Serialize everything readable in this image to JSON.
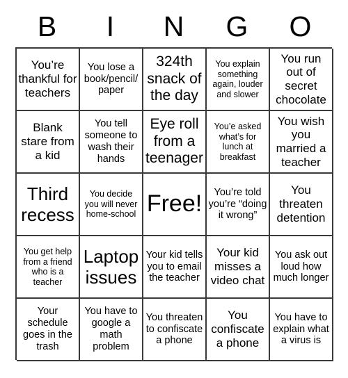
{
  "card": {
    "title": "BINGO",
    "header_letters": [
      "B",
      "I",
      "N",
      "G",
      "O"
    ],
    "grid_size": "5x5",
    "free_space_label": "Free!",
    "colors": {
      "background": "#ffffff",
      "text": "#000000",
      "border": "#3a3a3a"
    },
    "rows": [
      [
        {
          "text": "You’re thankful for teachers",
          "size": "md"
        },
        {
          "text": "You lose a book/pencil/paper",
          "size": "sm"
        },
        {
          "text": "324th snack of the day",
          "size": "lg"
        },
        {
          "text": "You explain something again, louder and slower",
          "size": "xs"
        },
        {
          "text": "You run out of secret chocolate",
          "size": "md"
        }
      ],
      [
        {
          "text": "Blank stare from a kid",
          "size": "md"
        },
        {
          "text": "You tell someone to wash their hands",
          "size": "sm"
        },
        {
          "text": "Eye roll from a teenager",
          "size": "lg"
        },
        {
          "text": "You’e asked what’s for lunch at breakfast",
          "size": "xs"
        },
        {
          "text": "You wish you married a teacher",
          "size": "md"
        }
      ],
      [
        {
          "text": "Third recess",
          "size": "xl"
        },
        {
          "text": "You decide you will never home-school",
          "size": "xs"
        },
        {
          "text": "Free!",
          "size": "xxl"
        },
        {
          "text": "You’re told you’re “doing it wrong”",
          "size": "sm"
        },
        {
          "text": "You threaten detention",
          "size": "md"
        }
      ],
      [
        {
          "text": "You get help from a friend who is a teacher",
          "size": "xs"
        },
        {
          "text": "Laptop issues",
          "size": "xl"
        },
        {
          "text": "Your kid tells you to email the teacher",
          "size": "sm"
        },
        {
          "text": "Your kid misses a video chat",
          "size": "md"
        },
        {
          "text": "You ask out loud how much longer",
          "size": "sm"
        }
      ],
      [
        {
          "text": "Your schedule goes in the trash",
          "size": "sm"
        },
        {
          "text": "You have to google a math problem",
          "size": "sm"
        },
        {
          "text": "You threaten to confiscate a phone",
          "size": "sm"
        },
        {
          "text": "You confiscate a phone",
          "size": "md"
        },
        {
          "text": "You have to explain what a virus is",
          "size": "sm"
        }
      ]
    ]
  }
}
